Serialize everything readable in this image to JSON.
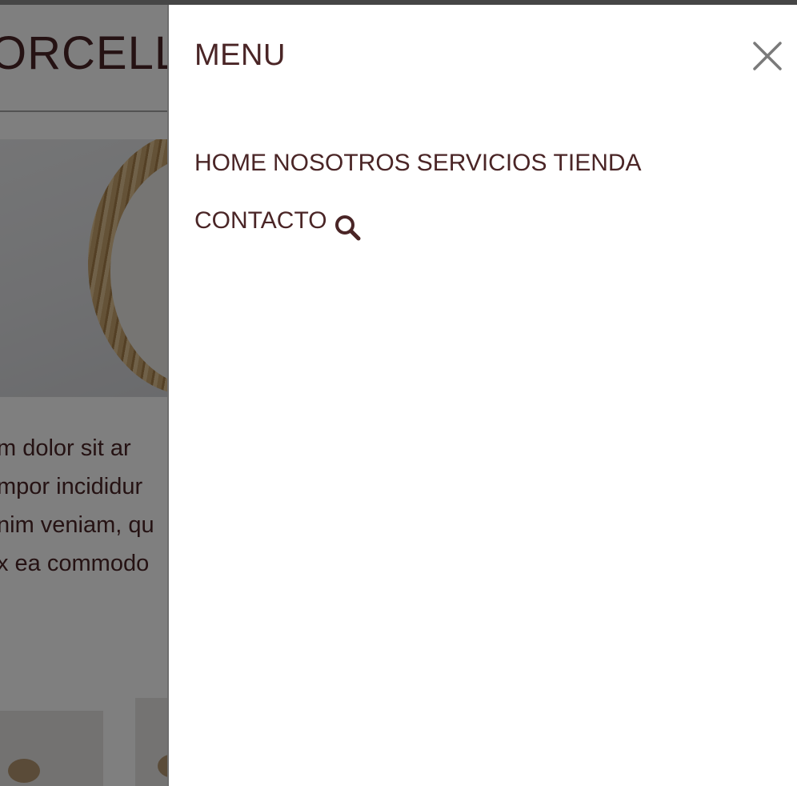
{
  "background": {
    "brand_text": "ORCELLE",
    "body_lines": [
      "m  dolor  sit  ar",
      "mpor  incididur",
      "nim veniam, qu",
      "x ea commodo "
    ]
  },
  "drawer": {
    "title": "MENU",
    "close_icon": "close-icon",
    "nav_items": [
      "HOME",
      "NOSOTROS",
      "SERVICIOS",
      "TIENDA",
      "CONTACTO"
    ],
    "search_icon": "search-icon"
  },
  "colors": {
    "text": "#4a2526",
    "overlay": "rgba(0,0,0,0.5)",
    "close_icon": "#7a7a7a"
  }
}
